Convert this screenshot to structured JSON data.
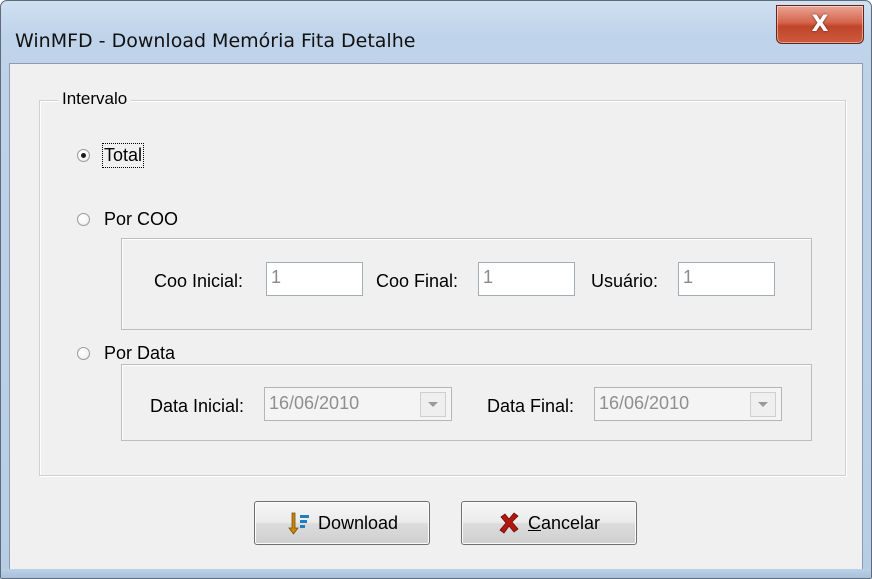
{
  "window": {
    "title": "WinMFD - Download Memória Fita Detalhe",
    "close_glyph": "X"
  },
  "group": {
    "legend": "Intervalo",
    "options": [
      {
        "label": "Total",
        "checked": true
      },
      {
        "label": "Por COO",
        "checked": false
      },
      {
        "label": "Por Data",
        "checked": false
      }
    ]
  },
  "coo": {
    "inicial_label": "Coo Inicial:",
    "inicial_value": "1",
    "final_label": "Coo Final:",
    "final_value": "1",
    "usuario_label": "Usuário:",
    "usuario_value": "1"
  },
  "data": {
    "inicial_label": "Data Inicial:",
    "inicial_value": "16/06/2010",
    "final_label": "Data Final:",
    "final_value": "16/06/2010"
  },
  "buttons": {
    "download_label": "Download",
    "cancel_accel": "C",
    "cancel_rest": "ancelar"
  },
  "icons": {
    "download": "download-icon",
    "cancel": "cancel-icon"
  },
  "colors": {
    "cancel_icon": "#b0180b",
    "download_icon": "#c8860d"
  }
}
